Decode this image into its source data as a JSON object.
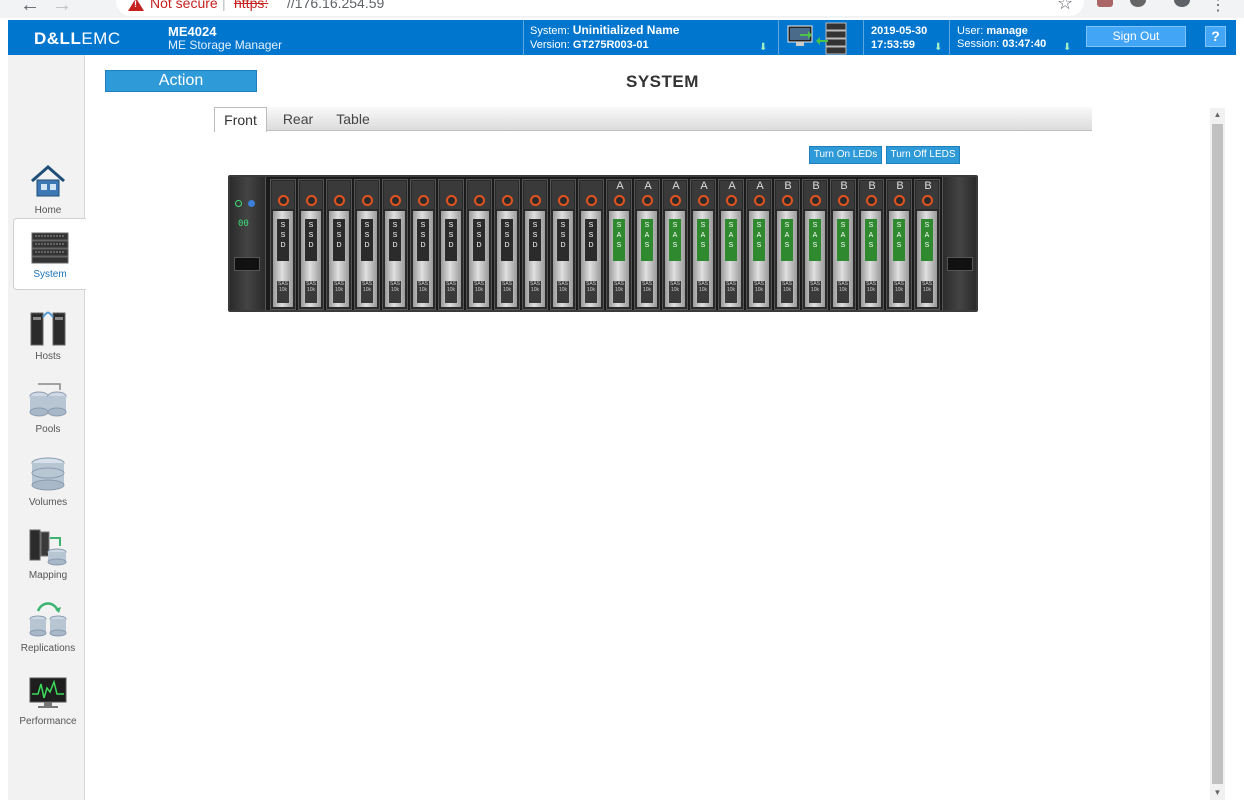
{
  "browser": {
    "security_label": "Not secure",
    "url_separator": "|",
    "url_scheme": "https:",
    "url_host": "//176.16.254.59"
  },
  "header": {
    "logo_brand": "D&LL",
    "logo_suffix": "EMC",
    "product_model": "ME4024",
    "product_name": "ME Storage Manager",
    "system_label": "System:",
    "system_name": "Uninitialized Name",
    "version_label": "Version:",
    "version_value": "GT275R003-01",
    "date": "2019-05-30",
    "time": "17:53:59",
    "user_label": "User:",
    "user_name": "manage",
    "session_label": "Session:",
    "session_value": "03:47:40",
    "sign_out_label": "Sign Out",
    "help_label": "?"
  },
  "sidebar": {
    "items": [
      {
        "label": "Home",
        "icon": "home-icon"
      },
      {
        "label": "System",
        "icon": "system-icon"
      },
      {
        "label": "Hosts",
        "icon": "hosts-icon"
      },
      {
        "label": "Pools",
        "icon": "pools-icon"
      },
      {
        "label": "Volumes",
        "icon": "volumes-icon"
      },
      {
        "label": "Mapping",
        "icon": "mapping-icon"
      },
      {
        "label": "Replications",
        "icon": "replications-icon"
      },
      {
        "label": "Performance",
        "icon": "performance-icon"
      }
    ],
    "active": "System"
  },
  "main": {
    "action_label": "Action",
    "title": "SYSTEM",
    "tabs": [
      {
        "label": "Front"
      },
      {
        "label": "Rear"
      },
      {
        "label": "Table"
      }
    ],
    "active_tab": "Front",
    "led_on_label": "Turn On LEDs",
    "led_off_label": "Turn Off LEDS"
  },
  "enclosure": {
    "status_display": "00",
    "bays": [
      {
        "group": "",
        "type": "SSD"
      },
      {
        "group": "",
        "type": "SSD"
      },
      {
        "group": "",
        "type": "SSD"
      },
      {
        "group": "",
        "type": "SSD"
      },
      {
        "group": "",
        "type": "SSD"
      },
      {
        "group": "",
        "type": "SSD"
      },
      {
        "group": "",
        "type": "SSD"
      },
      {
        "group": "",
        "type": "SSD"
      },
      {
        "group": "",
        "type": "SSD"
      },
      {
        "group": "",
        "type": "SSD"
      },
      {
        "group": "",
        "type": "SSD"
      },
      {
        "group": "",
        "type": "SSD"
      },
      {
        "group": "A",
        "type": "SAS"
      },
      {
        "group": "A",
        "type": "SAS"
      },
      {
        "group": "A",
        "type": "SAS"
      },
      {
        "group": "A",
        "type": "SAS"
      },
      {
        "group": "A",
        "type": "SAS"
      },
      {
        "group": "A",
        "type": "SAS"
      },
      {
        "group": "B",
        "type": "SAS"
      },
      {
        "group": "B",
        "type": "SAS"
      },
      {
        "group": "B",
        "type": "SAS"
      },
      {
        "group": "B",
        "type": "SAS"
      },
      {
        "group": "B",
        "type": "SAS"
      },
      {
        "group": "B",
        "type": "SAS"
      }
    ],
    "grip_text": "SAS 10k",
    "colors": {
      "ssd_label": "#2b2b2b",
      "sas_label": "#2f8a2f",
      "bay_led": "#e0531f"
    }
  },
  "colors": {
    "header_bg": "#0076ce",
    "button_bg": "#2e9ad8"
  }
}
